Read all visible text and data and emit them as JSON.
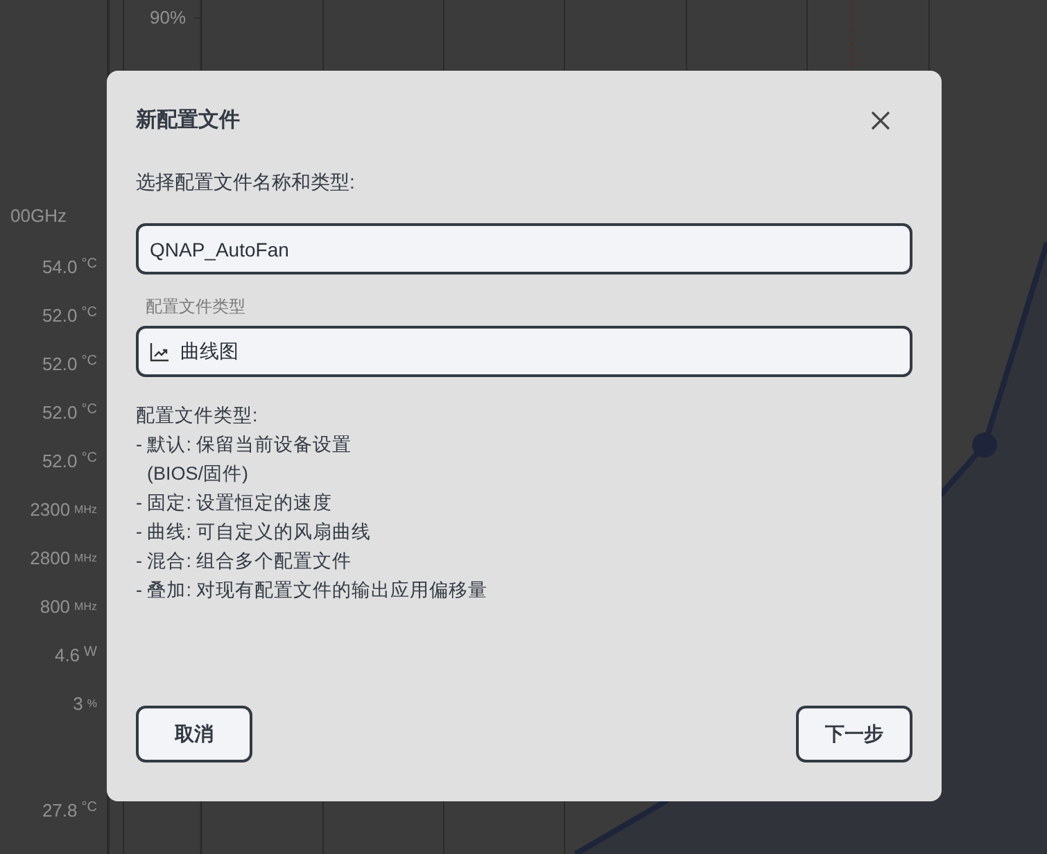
{
  "background": {
    "axis_label": "90%",
    "readings": [
      {
        "value": "00GHz"
      },
      {
        "value": "54.0",
        "unit": "°C"
      },
      {
        "value": "52.0",
        "unit": "°C"
      },
      {
        "value": "52.0",
        "unit": "°C"
      },
      {
        "value": "52.0",
        "unit": "°C"
      },
      {
        "value": "52.0",
        "unit": "°C"
      },
      {
        "value": "2300",
        "unit": "MHz"
      },
      {
        "value": "2800",
        "unit": "MHz"
      },
      {
        "value": "800",
        "unit": "MHz"
      },
      {
        "value": "4.6",
        "unit": "W"
      },
      {
        "value": "3",
        "unit": "%"
      },
      {
        "value": "27.8",
        "unit": "°C"
      }
    ]
  },
  "dialog": {
    "title": "新配置文件",
    "prompt": "选择配置文件名称和类型:",
    "name_field": {
      "value": "QNAP_AutoFan"
    },
    "type_label": "配置文件类型",
    "type_field": {
      "value": "曲线图"
    },
    "description": {
      "heading": "配置文件类型:",
      "items": [
        {
          "text": "- 默认: 保留当前设备设置",
          "continuation": "(BIOS/固件)"
        },
        {
          "text": "- 固定: 设置恒定的速度"
        },
        {
          "text": "- 曲线: 可自定义的风扇曲线"
        },
        {
          "text": "- 混合: 组合多个配置文件"
        },
        {
          "text": "- 叠加: 对现有配置文件的输出应用偏移量"
        }
      ]
    },
    "buttons": [
      "取消",
      "下一步"
    ]
  }
}
